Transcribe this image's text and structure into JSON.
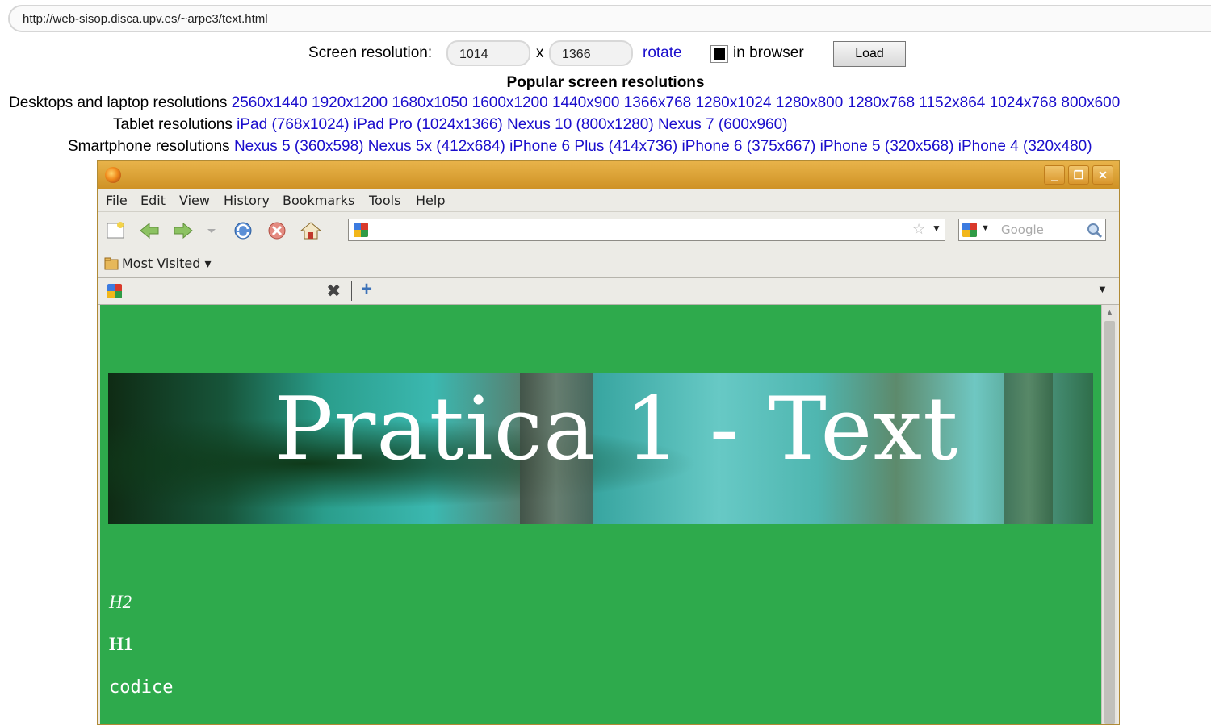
{
  "url": "http://web-sisop.disca.upv.es/~arpe3/text.html",
  "controls": {
    "screen_resolution_label": "Screen resolution:",
    "width_value": "1014",
    "x_label": "x",
    "height_value": "1366",
    "rotate_label": "rotate",
    "in_browser_label": "in browser",
    "load_label": "Load"
  },
  "popular": {
    "title": "Popular screen resolutions",
    "desktops_label": "Desktops and laptop resolutions",
    "desktops": [
      "2560x1440",
      "1920x1200",
      "1680x1050",
      "1600x1200",
      "1440x900",
      "1366x768",
      "1280x1024",
      "1280x800",
      "1280x768",
      "1152x864",
      "1024x768",
      "800x600"
    ],
    "tablets_label": "Tablet resolutions",
    "tablets": [
      "iPad (768x1024)",
      "iPad Pro (1024x1366)",
      "Nexus 10 (800x1280)",
      "Nexus 7 (600x960)"
    ],
    "smartphones_label": "Smartphone resolutions",
    "smartphones": [
      "Nexus 5 (360x598)",
      "Nexus 5x (412x684)",
      "iPhone 6 Plus (414x736)",
      "iPhone 6 (375x667)",
      "iPhone 5 (320x568)",
      "iPhone 4 (320x480)"
    ]
  },
  "browser": {
    "menu": [
      "File",
      "Edit",
      "View",
      "History",
      "Bookmarks",
      "Tools",
      "Help"
    ],
    "search_placeholder": "Google",
    "most_visited": "Most Visited"
  },
  "page": {
    "banner_title": "Pratica 1 - Text",
    "h2": "H2",
    "h1": "H1",
    "code": "codice",
    "background_color": "#2eaa4c"
  }
}
